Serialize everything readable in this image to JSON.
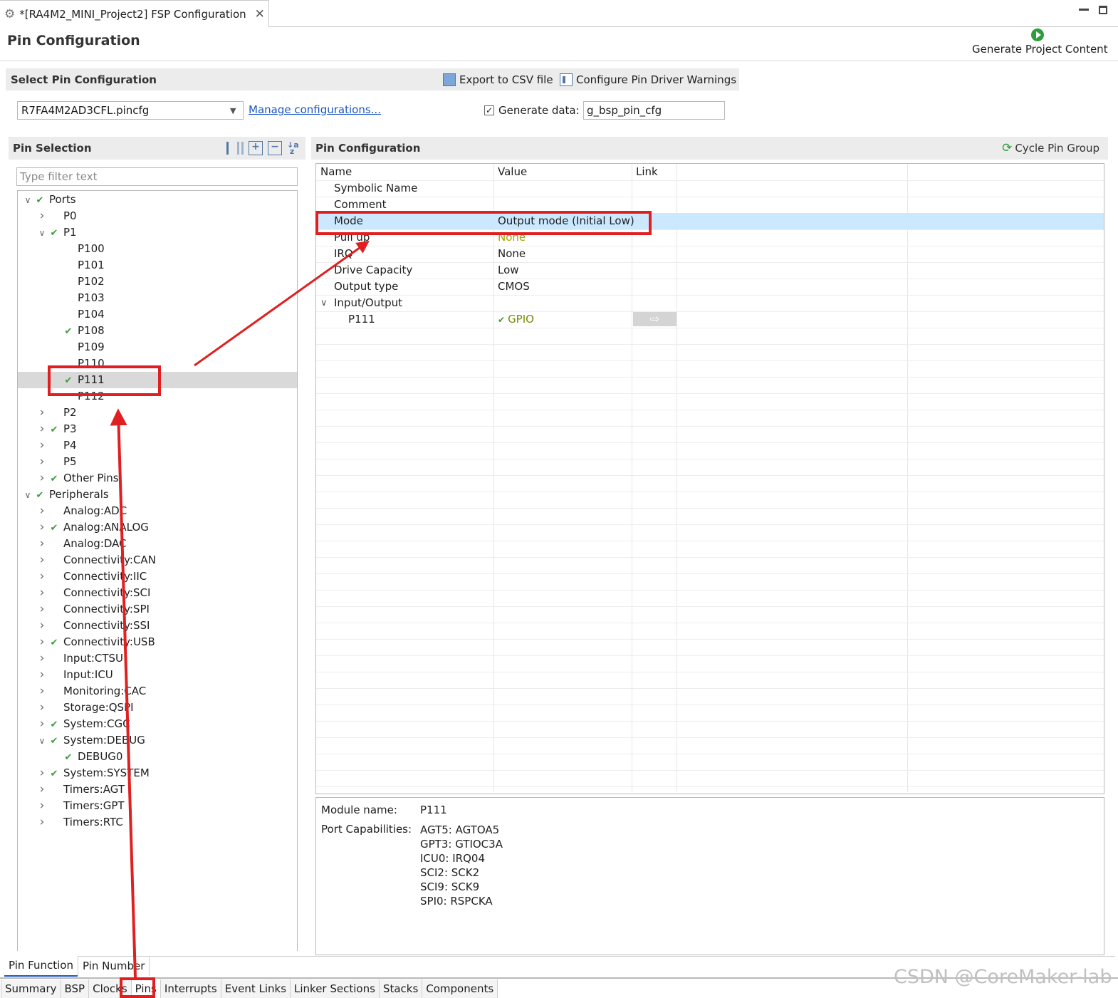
{
  "window": {
    "tab_title": "*[RA4M2_MINI_Project2] FSP Configuration",
    "page_title": "Pin Configuration",
    "generate_label": "Generate Project Content"
  },
  "select_config": {
    "heading": "Select Pin Configuration",
    "export_csv": "Export to CSV file",
    "configure_warnings": "Configure Pin Driver Warnings",
    "file_value": "R7FA4M2AD3CFL.pincfg",
    "manage_link": "Manage configurations...",
    "generate_data_label": "Generate data:",
    "generate_data_checked": true,
    "generate_data_value": "g_bsp_pin_cfg"
  },
  "pin_selection": {
    "heading": "Pin Selection",
    "filter_placeholder": "Type filter text",
    "tree": [
      {
        "label": "Ports",
        "level": 0,
        "expand": "open",
        "checked": true
      },
      {
        "label": "P0",
        "level": 1,
        "expand": "closed",
        "checked": false
      },
      {
        "label": "P1",
        "level": 1,
        "expand": "open",
        "checked": true
      },
      {
        "label": "P100",
        "level": 2,
        "expand": "none",
        "checked": false
      },
      {
        "label": "P101",
        "level": 2,
        "expand": "none",
        "checked": false
      },
      {
        "label": "P102",
        "level": 2,
        "expand": "none",
        "checked": false
      },
      {
        "label": "P103",
        "level": 2,
        "expand": "none",
        "checked": false
      },
      {
        "label": "P104",
        "level": 2,
        "expand": "none",
        "checked": false
      },
      {
        "label": "P108",
        "level": 2,
        "expand": "none",
        "checked": true
      },
      {
        "label": "P109",
        "level": 2,
        "expand": "none",
        "checked": false
      },
      {
        "label": "P110",
        "level": 2,
        "expand": "none",
        "checked": false
      },
      {
        "label": "P111",
        "level": 2,
        "expand": "none",
        "checked": true,
        "selected": true
      },
      {
        "label": "P112",
        "level": 2,
        "expand": "none",
        "checked": false
      },
      {
        "label": "P2",
        "level": 1,
        "expand": "closed",
        "checked": false
      },
      {
        "label": "P3",
        "level": 1,
        "expand": "closed",
        "checked": true
      },
      {
        "label": "P4",
        "level": 1,
        "expand": "closed",
        "checked": false
      },
      {
        "label": "P5",
        "level": 1,
        "expand": "closed",
        "checked": false
      },
      {
        "label": "Other Pins",
        "level": 1,
        "expand": "closed",
        "checked": true
      },
      {
        "label": "Peripherals",
        "level": 0,
        "expand": "open",
        "checked": true
      },
      {
        "label": "Analog:ADC",
        "level": 1,
        "expand": "closed",
        "checked": false
      },
      {
        "label": "Analog:ANALOG",
        "level": 1,
        "expand": "closed",
        "checked": true
      },
      {
        "label": "Analog:DAC",
        "level": 1,
        "expand": "closed",
        "checked": false
      },
      {
        "label": "Connectivity:CAN",
        "level": 1,
        "expand": "closed",
        "checked": false
      },
      {
        "label": "Connectivity:IIC",
        "level": 1,
        "expand": "closed",
        "checked": false
      },
      {
        "label": "Connectivity:SCI",
        "level": 1,
        "expand": "closed",
        "checked": false
      },
      {
        "label": "Connectivity:SPI",
        "level": 1,
        "expand": "closed",
        "checked": false
      },
      {
        "label": "Connectivity:SSI",
        "level": 1,
        "expand": "closed",
        "checked": false
      },
      {
        "label": "Connectivity:USB",
        "level": 1,
        "expand": "closed",
        "checked": true
      },
      {
        "label": "Input:CTSU",
        "level": 1,
        "expand": "closed",
        "checked": false
      },
      {
        "label": "Input:ICU",
        "level": 1,
        "expand": "closed",
        "checked": false
      },
      {
        "label": "Monitoring:CAC",
        "level": 1,
        "expand": "closed",
        "checked": false
      },
      {
        "label": "Storage:QSPI",
        "level": 1,
        "expand": "closed",
        "checked": false
      },
      {
        "label": "System:CGC",
        "level": 1,
        "expand": "closed",
        "checked": true
      },
      {
        "label": "System:DEBUG",
        "level": 1,
        "expand": "open",
        "checked": true
      },
      {
        "label": "DEBUG0",
        "level": 2,
        "expand": "none",
        "checked": true
      },
      {
        "label": "System:SYSTEM",
        "level": 1,
        "expand": "closed",
        "checked": true
      },
      {
        "label": "Timers:AGT",
        "level": 1,
        "expand": "closed",
        "checked": false
      },
      {
        "label": "Timers:GPT",
        "level": 1,
        "expand": "closed",
        "checked": false
      },
      {
        "label": "Timers:RTC",
        "level": 1,
        "expand": "closed",
        "checked": false
      }
    ],
    "bottom_tabs": [
      "Pin Function",
      "Pin Number"
    ]
  },
  "pin_config": {
    "heading": "Pin Configuration",
    "cycle_label": "Cycle Pin Group",
    "columns": [
      "Name",
      "Value",
      "Link"
    ],
    "rows": [
      {
        "name": "Symbolic Name",
        "value": "",
        "indent": 1
      },
      {
        "name": "Comment",
        "value": "",
        "indent": 1
      },
      {
        "name": "Mode",
        "value": "Output mode (Initial Low)",
        "indent": 1,
        "selected": true
      },
      {
        "name": "Pull up",
        "value": "None",
        "indent": 1,
        "value_color": "#a8a000"
      },
      {
        "name": "IRQ",
        "value": "None",
        "indent": 1
      },
      {
        "name": "Drive Capacity",
        "value": "Low",
        "indent": 1
      },
      {
        "name": "Output type",
        "value": "CMOS",
        "indent": 1
      },
      {
        "name": "Input/Output",
        "value": "",
        "indent": 1,
        "expand": "open"
      },
      {
        "name": "P111",
        "value": "GPIO",
        "indent": 2,
        "value_color": "#7a8a00",
        "value_checked": true,
        "link_button": true
      }
    ],
    "module_label": "Module name:",
    "module_value": "P111",
    "capabilities_label": "Port Capabilities:",
    "capabilities": [
      "AGT5: AGTOA5",
      "GPT3: GTIOC3A",
      "ICU0: IRQ04",
      "SCI2: SCK2",
      "SCI9: SCK9",
      "SPI0: RSPCKA"
    ]
  },
  "editor_tabs": [
    "Summary",
    "BSP",
    "Clocks",
    "Pins",
    "Interrupts",
    "Event Links",
    "Linker Sections",
    "Stacks",
    "Components"
  ],
  "active_editor_tab": "Pins",
  "watermark": "CSDN @CoreMaker-lab",
  "colors": {
    "selection": "#cce8ff",
    "tree_selection": "#d9d9d9",
    "annotation_red": "#e02020",
    "check_green": "#3c9a3c"
  }
}
